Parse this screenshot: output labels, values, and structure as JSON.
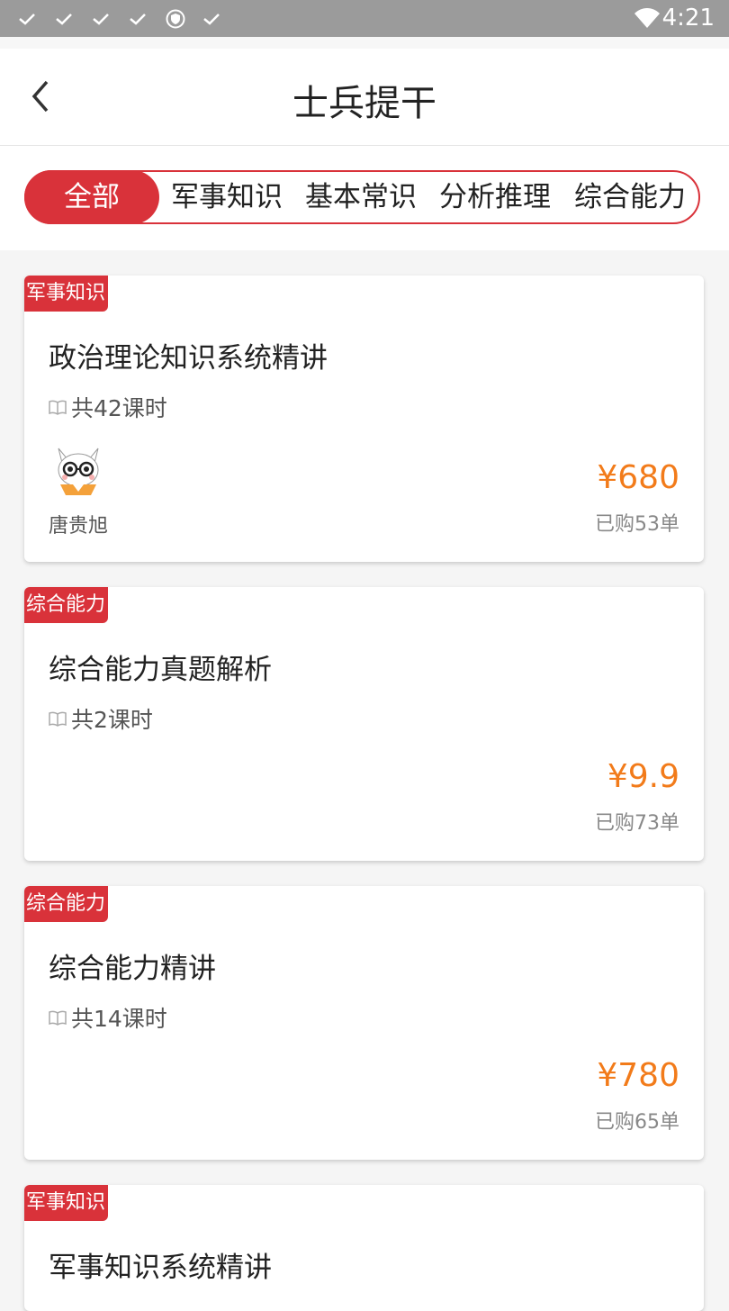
{
  "status_bar": {
    "time": "4:21",
    "icons": [
      "check-icon",
      "check-icon",
      "check-icon",
      "check-icon",
      "shield-icon",
      "check-icon",
      "wifi-icon"
    ]
  },
  "header": {
    "title": "士兵提干",
    "back_icon": "chevron-left-icon"
  },
  "filters": {
    "selected": "全部",
    "tabs": [
      "全部",
      "军事知识",
      "基本常识",
      "分析推理",
      "综合能力"
    ]
  },
  "courses": [
    {
      "tag": "军事知识",
      "title": "政治理论知识系统精讲",
      "lessons": "共42课时",
      "teacher": "唐贵旭",
      "price": "¥680",
      "sold": "已购53单"
    },
    {
      "tag": "综合能力",
      "title": "综合能力真题解析",
      "lessons": "共2课时",
      "price": "¥9.9",
      "sold": "已购73单"
    },
    {
      "tag": "综合能力",
      "title": "综合能力精讲",
      "lessons": "共14课时",
      "price": "¥780",
      "sold": "已购65单"
    },
    {
      "tag": "军事知识",
      "title": "军事知识系统精讲"
    }
  ],
  "colors": {
    "accent": "#d9323a",
    "price": "#f27b1a",
    "status_bar": "#9b9b9b"
  }
}
